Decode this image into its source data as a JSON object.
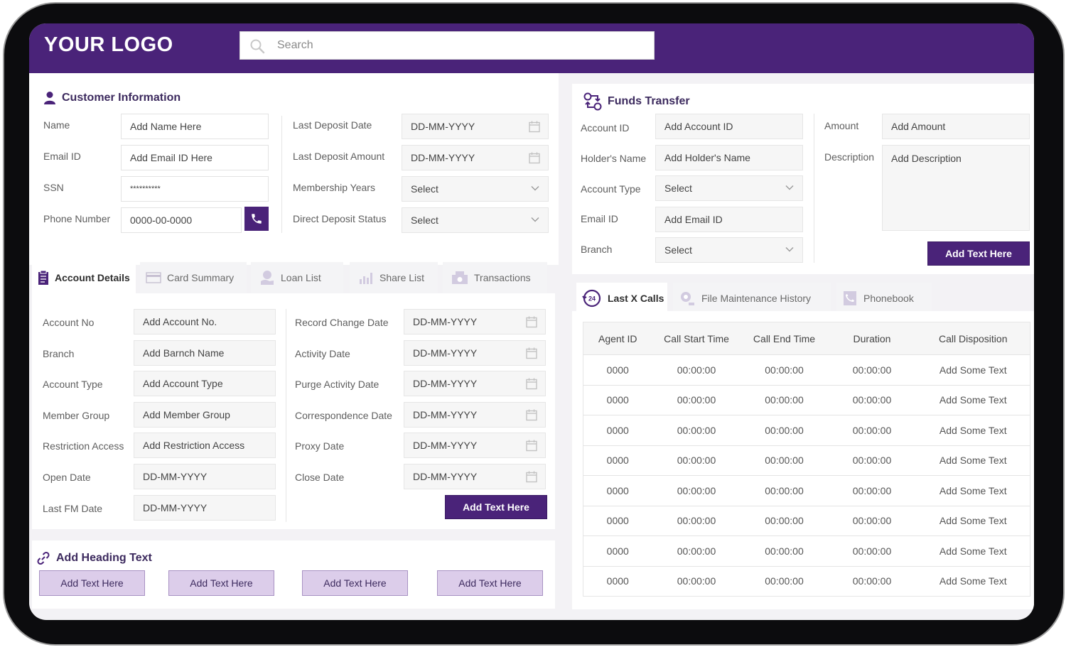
{
  "header": {
    "logo": "YOUR LOGO",
    "search_placeholder": "Search"
  },
  "customer": {
    "title": "Customer Information",
    "labels": {
      "name": "Name",
      "email": "Email ID",
      "ssn": "SSN",
      "phone": "Phone Number",
      "last_deposit_date": "Last Deposit Date",
      "last_deposit_amount": "Last Deposit Amount",
      "membership_years": "Membership Years",
      "direct_deposit_status": "Direct Deposit Status"
    },
    "values": {
      "name": "Add Name Here",
      "email": "Add Email ID Here",
      "ssn": "**********",
      "phone": "0000-00-0000",
      "last_deposit_date": "DD-MM-YYYY",
      "last_deposit_amount": "DD-MM-YYYY",
      "membership_years": "Select",
      "direct_deposit_status": "Select"
    }
  },
  "account_tabs": [
    "Account Details",
    "Card Summary",
    "Loan List",
    "Share List",
    "Transactions"
  ],
  "account": {
    "labels": {
      "account_no": "Account No",
      "branch": "Branch",
      "account_type": "Account Type",
      "member_group": "Member Group",
      "restriction_access": "Restriction Access",
      "open_date": "Open Date",
      "last_fm_date": "Last FM Date",
      "record_change_date": "Record Change Date",
      "activity_date": "Activity Date",
      "purge_activity_date": "Purge Activity Date",
      "correspondence_date": "Correspondence Date",
      "proxy_date": "Proxy Date",
      "close_date": "Close Date"
    },
    "values": {
      "account_no": "Add Account No.",
      "branch": "Add Barnch Name",
      "account_type": "Add Account Type",
      "member_group": "Add Member Group",
      "restriction_access": "Add Restriction Access",
      "open_date": "DD-MM-YYYY",
      "last_fm_date": "DD-MM-YYYY",
      "record_change_date": "DD-MM-YYYY",
      "activity_date": "DD-MM-YYYY",
      "purge_activity_date": "DD-MM-YYYY",
      "correspondence_date": "DD-MM-YYYY",
      "proxy_date": "DD-MM-YYYY",
      "close_date": "DD-MM-YYYY"
    },
    "button": "Add Text Here"
  },
  "heading_section": {
    "title": "Add Heading Text",
    "buttons": [
      "Add Text Here",
      "Add Text Here",
      "Add Text Here",
      "Add Text Here"
    ]
  },
  "funds": {
    "title": "Funds Transfer",
    "labels": {
      "account_id": "Account ID",
      "holder_name": "Holder's Name",
      "account_type": "Account Type",
      "email": "Email ID",
      "branch": "Branch",
      "amount": "Amount",
      "description": "Description"
    },
    "values": {
      "account_id": "Add Account ID",
      "holder_name": "Add Holder's Name",
      "account_type": "Select",
      "email": "Add Email ID",
      "branch": "Select",
      "amount": "Add Amount",
      "description": "Add Description"
    },
    "button": "Add Text Here"
  },
  "calls_tabs": [
    "Last X Calls",
    "File Maintenance History",
    "Phonebook"
  ],
  "calls": {
    "headers": [
      "Agent ID",
      "Call Start Time",
      "Call End Time",
      "Duration",
      "Call Disposition"
    ],
    "rows": [
      [
        "0000",
        "00:00:00",
        "00:00:00",
        "00:00:00",
        "Add Some Text"
      ],
      [
        "0000",
        "00:00:00",
        "00:00:00",
        "00:00:00",
        "Add Some Text"
      ],
      [
        "0000",
        "00:00:00",
        "00:00:00",
        "00:00:00",
        "Add Some Text"
      ],
      [
        "0000",
        "00:00:00",
        "00:00:00",
        "00:00:00",
        "Add Some Text"
      ],
      [
        "0000",
        "00:00:00",
        "00:00:00",
        "00:00:00",
        "Add Some Text"
      ],
      [
        "0000",
        "00:00:00",
        "00:00:00",
        "00:00:00",
        "Add Some Text"
      ],
      [
        "0000",
        "00:00:00",
        "00:00:00",
        "00:00:00",
        "Add Some Text"
      ],
      [
        "0000",
        "00:00:00",
        "00:00:00",
        "00:00:00",
        "Add Some Text"
      ]
    ]
  },
  "colors": {
    "brand": "#4a2379",
    "brand_light": "#dccdea",
    "background": "#f3f2f5"
  }
}
